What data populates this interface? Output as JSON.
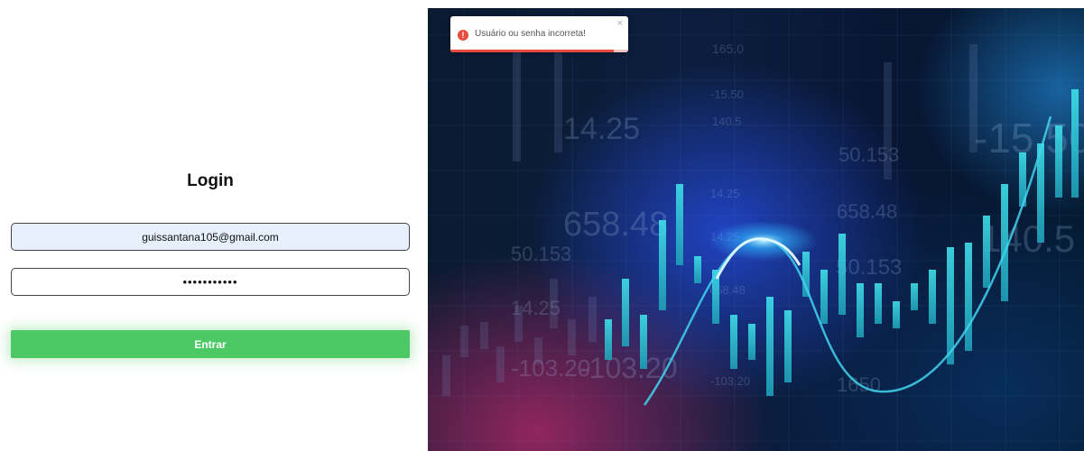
{
  "login": {
    "title": "Login",
    "email_value": "guissantana105@gmail.com",
    "password_value": "•••••••••••",
    "submit_label": "Entrar"
  },
  "toast": {
    "message": "Usuário ou senha incorreta!",
    "icon": "error-icon",
    "close_symbol": "×",
    "progress_remaining": 0.92
  },
  "hero": {
    "background_numbers": [
      "165.0",
      "-15.50",
      "140.5",
      "14.25",
      "50.153",
      "658.48",
      "50.153",
      "14.25",
      "14.25",
      "658.48",
      "50.153",
      "14.25",
      "658.48",
      "-103.20",
      "-103.20",
      "-103.20",
      "1650",
      "-15.50",
      "140.5"
    ]
  },
  "colors": {
    "accent_green": "#4cc864",
    "error_red": "#e74c3c",
    "input_autofill_bg": "#e8f0fe"
  }
}
